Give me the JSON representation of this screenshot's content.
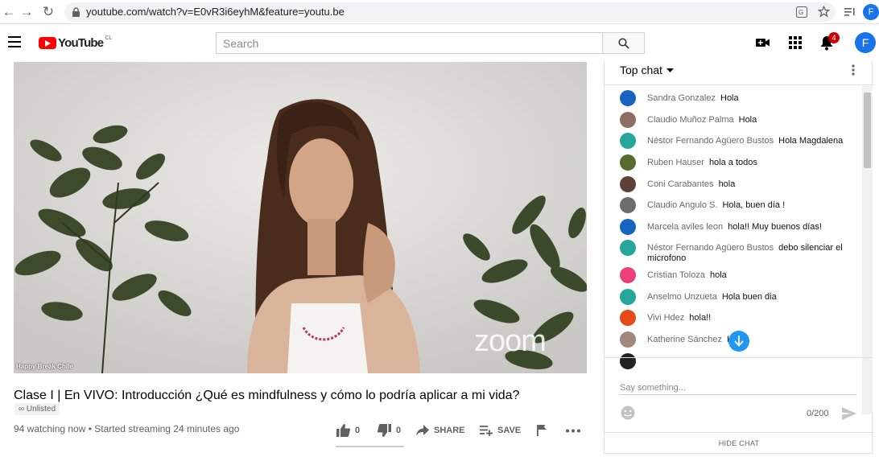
{
  "browser": {
    "url": "youtube.com/watch?v=E0vR3i6eyhM&feature=youtu.be",
    "profile_initial": "F"
  },
  "header": {
    "logo_text": "YouTube",
    "logo_country": "CL",
    "search_placeholder": "Search",
    "notification_count": "4",
    "avatar_initial": "F"
  },
  "video": {
    "overlay_name": "Happy Break Chile",
    "watermark": "zoom"
  },
  "info": {
    "title": "Clase I | En VIVO: Introducción ¿Qué es mindfulness y cómo lo podría aplicar a mi vida?",
    "badge": "Unlisted",
    "views": "94 watching now",
    "started": "Started streaming 24 minutes ago",
    "likes": "0",
    "dislikes": "0",
    "share_label": "SHARE",
    "save_label": "SAVE"
  },
  "chat": {
    "header_label": "Top chat",
    "input_placeholder": "Say something...",
    "char_count": "0/200",
    "hide_chat_label": "HIDE CHAT",
    "messages": [
      {
        "author": "Sandra Gonzalez",
        "text": "Hola",
        "avatar_color": "#1565c0"
      },
      {
        "author": "Claudio Muñoz Palma",
        "text": "Hola",
        "avatar_color": "#8d6e63"
      },
      {
        "author": "Néstor Fernando Agüero Bustos",
        "text": "Hola Magdalena",
        "avatar_color": "#26a69a"
      },
      {
        "author": "Ruben Hauser",
        "text": "hola a todos",
        "avatar_color": "#556b2f"
      },
      {
        "author": "Coni Carabantes",
        "text": "hola",
        "avatar_color": "#5d4037"
      },
      {
        "author": "Claudio Angulo S.",
        "text": "Hola, buen día !",
        "avatar_color": "#6d6d6d"
      },
      {
        "author": "Marcela aviles leon",
        "text": "hola!! Muy buenos días!",
        "avatar_color": "#1565c0"
      },
      {
        "author": "Néstor Fernando Agüero Bustos",
        "text": "debo silenciar el microfono",
        "avatar_color": "#26a69a"
      },
      {
        "author": "Cristian Toloza",
        "text": "hola",
        "avatar_color": "#ec407a"
      },
      {
        "author": "Anselmo Unzueta",
        "text": "Hola buen dia",
        "avatar_color": "#26a69a"
      },
      {
        "author": "Vivi Hdez",
        "text": "hola!!",
        "avatar_color": "#e64a19"
      },
      {
        "author": "Katherine Sánchez",
        "text": "H",
        "avatar_color": "#a1887f"
      }
    ]
  }
}
